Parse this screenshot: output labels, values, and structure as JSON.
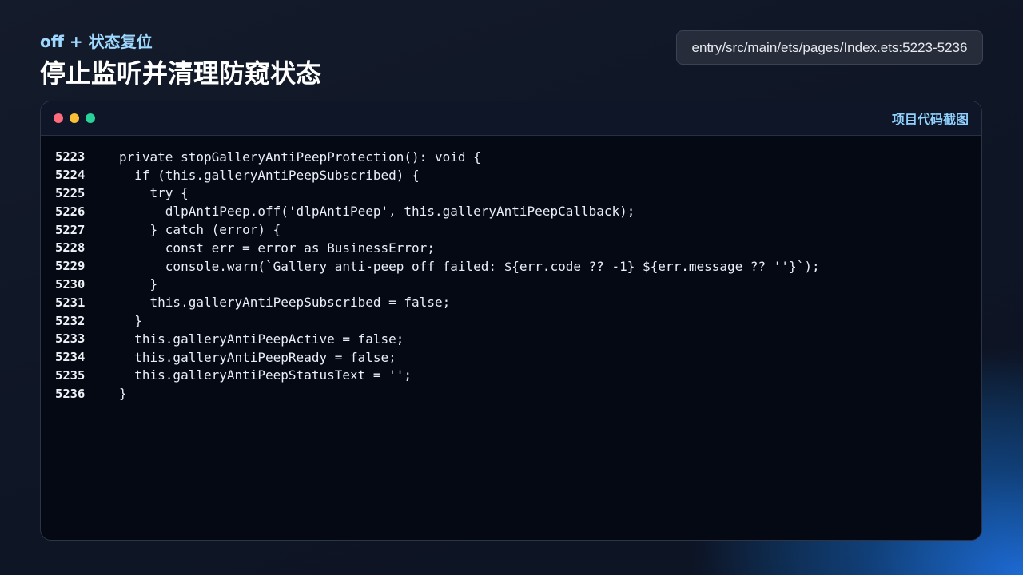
{
  "header": {
    "subtitle": "off + 状态复位",
    "title": "停止监听并清理防窥状态"
  },
  "file_path": "entry/src/main/ets/pages/Index.ets:5223-5236",
  "window": {
    "label": "项目代码截图",
    "dots": [
      "red",
      "yellow",
      "green"
    ]
  },
  "code_lines": [
    {
      "number": "5223",
      "text": "private stopGalleryAntiPeepProtection(): void {"
    },
    {
      "number": "5224",
      "text": "  if (this.galleryAntiPeepSubscribed) {"
    },
    {
      "number": "5225",
      "text": "    try {"
    },
    {
      "number": "5226",
      "text": "      dlpAntiPeep.off('dlpAntiPeep', this.galleryAntiPeepCallback);"
    },
    {
      "number": "5227",
      "text": "    } catch (error) {"
    },
    {
      "number": "5228",
      "text": "      const err = error as BusinessError;"
    },
    {
      "number": "5229",
      "text": "      console.warn(`Gallery anti-peep off failed: ${err.code ?? -1} ${err.message ?? ''}`);"
    },
    {
      "number": "5230",
      "text": "    }"
    },
    {
      "number": "5231",
      "text": "    this.galleryAntiPeepSubscribed = false;"
    },
    {
      "number": "5232",
      "text": "  }"
    },
    {
      "number": "5233",
      "text": "  this.galleryAntiPeepActive = false;"
    },
    {
      "number": "5234",
      "text": "  this.galleryAntiPeepReady = false;"
    },
    {
      "number": "5235",
      "text": "  this.galleryAntiPeepStatusText = '';"
    },
    {
      "number": "5236",
      "text": "}"
    }
  ],
  "colors": {
    "subtitle": "#9fd8ff",
    "window_label": "#8fd2ff",
    "dot_red": "#ff6b7d",
    "dot_yellow": "#f7c036",
    "dot_green": "#28d39a"
  }
}
